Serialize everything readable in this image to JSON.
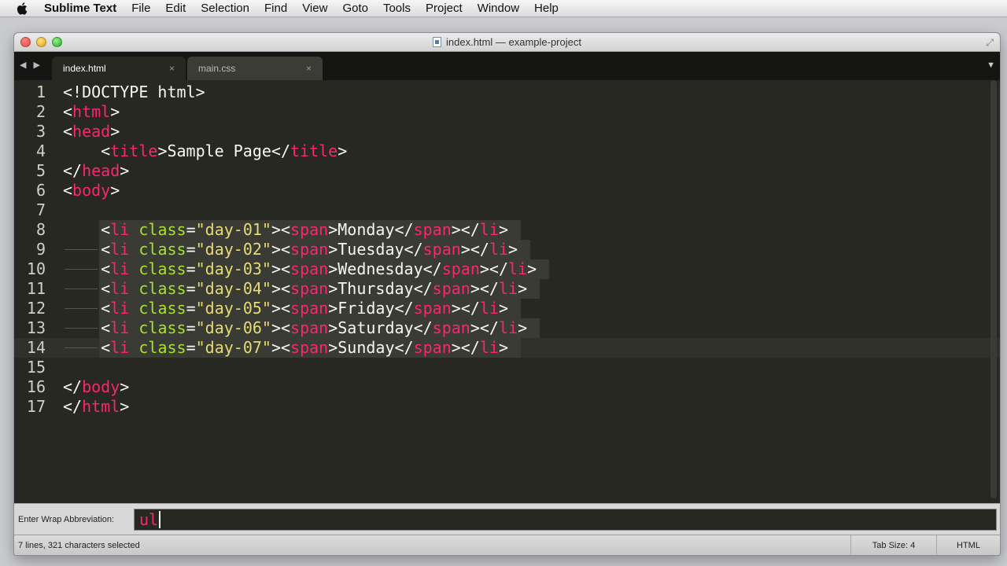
{
  "menubar": {
    "app_name": "Sublime Text",
    "items": [
      "File",
      "Edit",
      "Selection",
      "Find",
      "View",
      "Goto",
      "Tools",
      "Project",
      "Window",
      "Help"
    ]
  },
  "window": {
    "title": "index.html — example-project"
  },
  "tabs": [
    {
      "label": "index.html",
      "active": true
    },
    {
      "label": "main.css",
      "active": false
    }
  ],
  "tab_close_glyph": "×",
  "nav_arrows": "◀ ▶",
  "dropdown_glyph": "▼",
  "editor": {
    "lines": [
      {
        "n": "1",
        "tokens": [
          [
            "punc",
            "<!DOCTYPE html>"
          ]
        ]
      },
      {
        "n": "2",
        "tokens": [
          [
            "punc",
            "<"
          ],
          [
            "tag",
            "html"
          ],
          [
            "punc",
            ">"
          ]
        ]
      },
      {
        "n": "3",
        "tokens": [
          [
            "punc",
            "<"
          ],
          [
            "tag",
            "head"
          ],
          [
            "punc",
            ">"
          ]
        ]
      },
      {
        "n": "4",
        "tokens": [
          [
            "punc",
            "    <"
          ],
          [
            "tag",
            "title"
          ],
          [
            "punc",
            ">Sample Page</"
          ],
          [
            "tag",
            "title"
          ],
          [
            "punc",
            ">"
          ]
        ]
      },
      {
        "n": "5",
        "tokens": [
          [
            "punc",
            "</"
          ],
          [
            "tag",
            "head"
          ],
          [
            "punc",
            ">"
          ]
        ]
      },
      {
        "n": "6",
        "tokens": [
          [
            "punc",
            "<"
          ],
          [
            "tag",
            "body"
          ],
          [
            "punc",
            ">"
          ]
        ]
      },
      {
        "n": "7",
        "tokens": []
      },
      {
        "n": "8",
        "tokens": [
          [
            "punc",
            "    <"
          ],
          [
            "tag",
            "li"
          ],
          [
            "punc",
            " "
          ],
          [
            "attr",
            "class"
          ],
          [
            "punc",
            "="
          ],
          [
            "str",
            "\"day-01\""
          ],
          [
            "punc",
            ">"
          ],
          [
            "punc",
            "<"
          ],
          [
            "tag",
            "span"
          ],
          [
            "punc",
            ">Monday</"
          ],
          [
            "tag",
            "span"
          ],
          [
            "punc",
            "></"
          ],
          [
            "tag",
            "li"
          ],
          [
            "punc",
            ">"
          ]
        ]
      },
      {
        "n": "9",
        "tokens": [
          [
            "punc",
            "    <"
          ],
          [
            "tag",
            "li"
          ],
          [
            "punc",
            " "
          ],
          [
            "attr",
            "class"
          ],
          [
            "punc",
            "="
          ],
          [
            "str",
            "\"day-02\""
          ],
          [
            "punc",
            ">"
          ],
          [
            "punc",
            "<"
          ],
          [
            "tag",
            "span"
          ],
          [
            "punc",
            ">Tuesday</"
          ],
          [
            "tag",
            "span"
          ],
          [
            "punc",
            "></"
          ],
          [
            "tag",
            "li"
          ],
          [
            "punc",
            ">"
          ]
        ]
      },
      {
        "n": "10",
        "tokens": [
          [
            "punc",
            "    <"
          ],
          [
            "tag",
            "li"
          ],
          [
            "punc",
            " "
          ],
          [
            "attr",
            "class"
          ],
          [
            "punc",
            "="
          ],
          [
            "str",
            "\"day-03\""
          ],
          [
            "punc",
            ">"
          ],
          [
            "punc",
            "<"
          ],
          [
            "tag",
            "span"
          ],
          [
            "punc",
            ">Wednesday</"
          ],
          [
            "tag",
            "span"
          ],
          [
            "punc",
            "></"
          ],
          [
            "tag",
            "li"
          ],
          [
            "punc",
            ">"
          ]
        ]
      },
      {
        "n": "11",
        "tokens": [
          [
            "punc",
            "    <"
          ],
          [
            "tag",
            "li"
          ],
          [
            "punc",
            " "
          ],
          [
            "attr",
            "class"
          ],
          [
            "punc",
            "="
          ],
          [
            "str",
            "\"day-04\""
          ],
          [
            "punc",
            ">"
          ],
          [
            "punc",
            "<"
          ],
          [
            "tag",
            "span"
          ],
          [
            "punc",
            ">Thursday</"
          ],
          [
            "tag",
            "span"
          ],
          [
            "punc",
            "></"
          ],
          [
            "tag",
            "li"
          ],
          [
            "punc",
            ">"
          ]
        ]
      },
      {
        "n": "12",
        "tokens": [
          [
            "punc",
            "    <"
          ],
          [
            "tag",
            "li"
          ],
          [
            "punc",
            " "
          ],
          [
            "attr",
            "class"
          ],
          [
            "punc",
            "="
          ],
          [
            "str",
            "\"day-05\""
          ],
          [
            "punc",
            ">"
          ],
          [
            "punc",
            "<"
          ],
          [
            "tag",
            "span"
          ],
          [
            "punc",
            ">Friday</"
          ],
          [
            "tag",
            "span"
          ],
          [
            "punc",
            "></"
          ],
          [
            "tag",
            "li"
          ],
          [
            "punc",
            ">"
          ]
        ]
      },
      {
        "n": "13",
        "tokens": [
          [
            "punc",
            "    <"
          ],
          [
            "tag",
            "li"
          ],
          [
            "punc",
            " "
          ],
          [
            "attr",
            "class"
          ],
          [
            "punc",
            "="
          ],
          [
            "str",
            "\"day-06\""
          ],
          [
            "punc",
            ">"
          ],
          [
            "punc",
            "<"
          ],
          [
            "tag",
            "span"
          ],
          [
            "punc",
            ">Saturday</"
          ],
          [
            "tag",
            "span"
          ],
          [
            "punc",
            "></"
          ],
          [
            "tag",
            "li"
          ],
          [
            "punc",
            ">"
          ]
        ]
      },
      {
        "n": "14",
        "tokens": [
          [
            "punc",
            "    <"
          ],
          [
            "tag",
            "li"
          ],
          [
            "punc",
            " "
          ],
          [
            "attr",
            "class"
          ],
          [
            "punc",
            "="
          ],
          [
            "str",
            "\"day-07\""
          ],
          [
            "punc",
            ">"
          ],
          [
            "punc",
            "<"
          ],
          [
            "tag",
            "span"
          ],
          [
            "punc",
            ">Sunday</"
          ],
          [
            "tag",
            "span"
          ],
          [
            "punc",
            "></"
          ],
          [
            "tag",
            "li"
          ],
          [
            "punc",
            ">"
          ]
        ]
      },
      {
        "n": "15",
        "tokens": []
      },
      {
        "n": "16",
        "tokens": [
          [
            "punc",
            "</"
          ],
          [
            "tag",
            "body"
          ],
          [
            "punc",
            ">"
          ]
        ]
      },
      {
        "n": "17",
        "tokens": [
          [
            "punc",
            "</"
          ],
          [
            "tag",
            "html"
          ],
          [
            "punc",
            ">"
          ]
        ]
      }
    ],
    "selected_lines": [
      "8",
      "9",
      "10",
      "11",
      "12",
      "13",
      "14"
    ],
    "current_line": "14"
  },
  "panel": {
    "label": "Enter Wrap Abbreviation:",
    "value": "ul"
  },
  "status": {
    "selection": "7 lines, 321 characters selected",
    "tab_size": "Tab Size: 4",
    "syntax": "HTML"
  },
  "colors": {
    "tag": "#f92672",
    "attr": "#a6e22e",
    "string": "#e6db74",
    "text": "#f8f8f2",
    "background": "#272822"
  }
}
